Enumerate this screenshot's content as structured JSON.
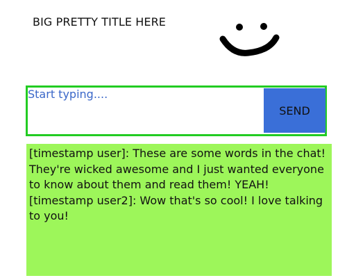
{
  "header": {
    "title": "BIG PRETTY TITLE HERE",
    "mascot_icon": "smiley-face-icon"
  },
  "composer": {
    "placeholder": "Start typing....",
    "value": "",
    "send_label": "SEND"
  },
  "chat": {
    "messages": [
      {
        "text": "[timestamp user]: These are some words in the chat! They're wicked awesome and I just wanted everyone to know about them and read them! YEAH!"
      },
      {
        "text": "[timestamp user2]: Wow that's so cool! I love talking to you!"
      }
    ]
  },
  "colors": {
    "composer_border": "#22cc22",
    "send_button": "#3a6fd8",
    "placeholder_text": "#3a67c9",
    "chat_background": "#9df65a"
  }
}
